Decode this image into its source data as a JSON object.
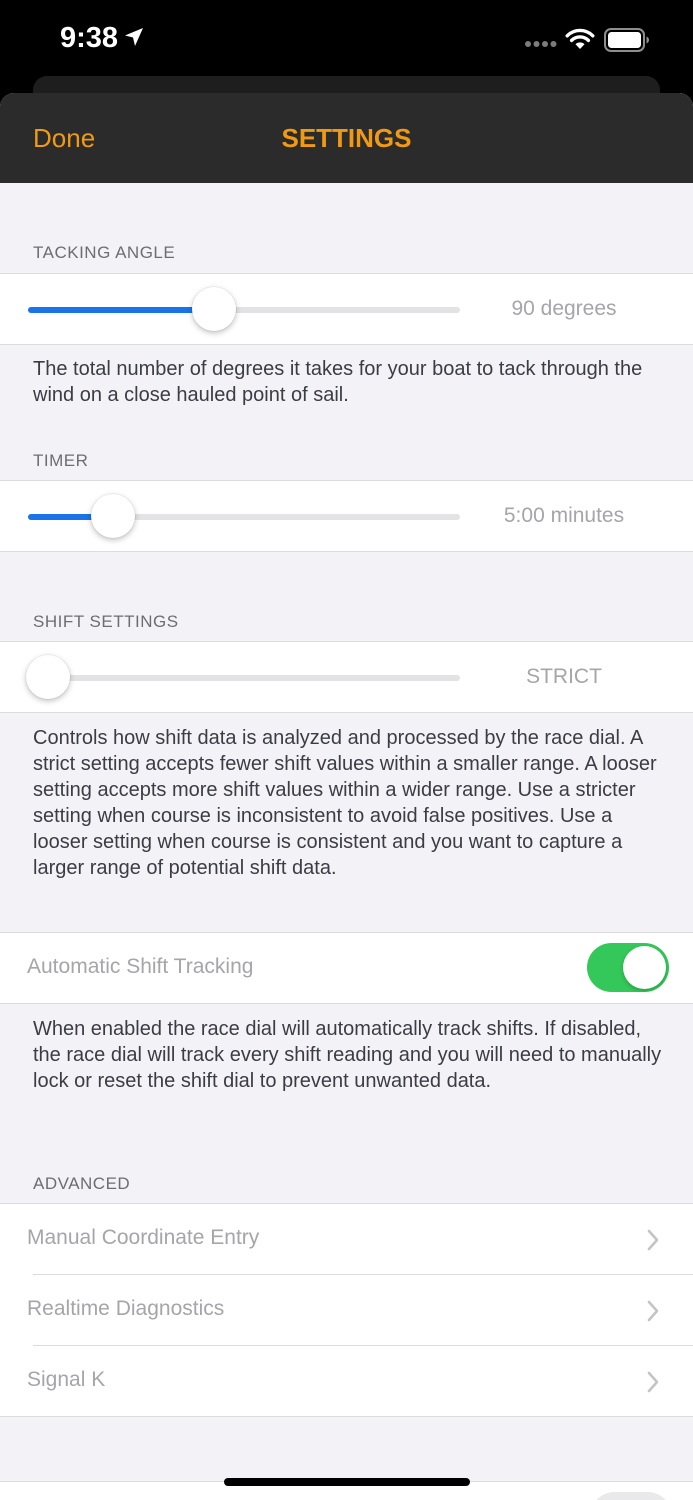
{
  "status_bar": {
    "time": "9:38"
  },
  "navbar": {
    "done_label": "Done",
    "title": "SETTINGS"
  },
  "tacking_angle": {
    "header": "TACKING ANGLE",
    "value_label": "90 degrees",
    "slider_fraction": 0.43,
    "description": "The total number of degrees it takes for your boat to tack through the wind on a close hauled point of sail."
  },
  "timer": {
    "header": "TIMER",
    "value_label": "5:00 minutes",
    "slider_fraction": 0.196
  },
  "shift_settings": {
    "header": "SHIFT SETTINGS",
    "value_label": "STRICT",
    "slider_fraction": 0.046,
    "description": "Controls how shift data is analyzed and processed by the race dial. A strict setting accepts fewer shift values within a smaller range. A looser setting accepts more shift values within a wider range. Use a stricter setting when course is inconsistent to avoid false positives. Use a looser setting when course is consistent and you want to capture a larger range of potential shift data."
  },
  "automatic_shift": {
    "label": "Automatic Shift Tracking",
    "enabled": true,
    "description": "When enabled the race dial will automatically track shifts. If disabled, the race dial will track every shift reading and you will need to manually lock or reset the shift dial to prevent unwanted data."
  },
  "advanced": {
    "header": "ADVANCED",
    "items": [
      {
        "label": "Manual Coordinate Entry"
      },
      {
        "label": "Realtime Diagnostics"
      },
      {
        "label": "Signal K"
      }
    ]
  },
  "colors": {
    "accent": "#f09a14",
    "slider_blue": "#1a73e8",
    "toggle_green": "#34c759",
    "navbar_bg": "#2b2b2b"
  },
  "icons": [
    "location-arrow-icon",
    "cellular-dots-icon",
    "wifi-icon",
    "battery-icon",
    "chevron-right-icon"
  ]
}
